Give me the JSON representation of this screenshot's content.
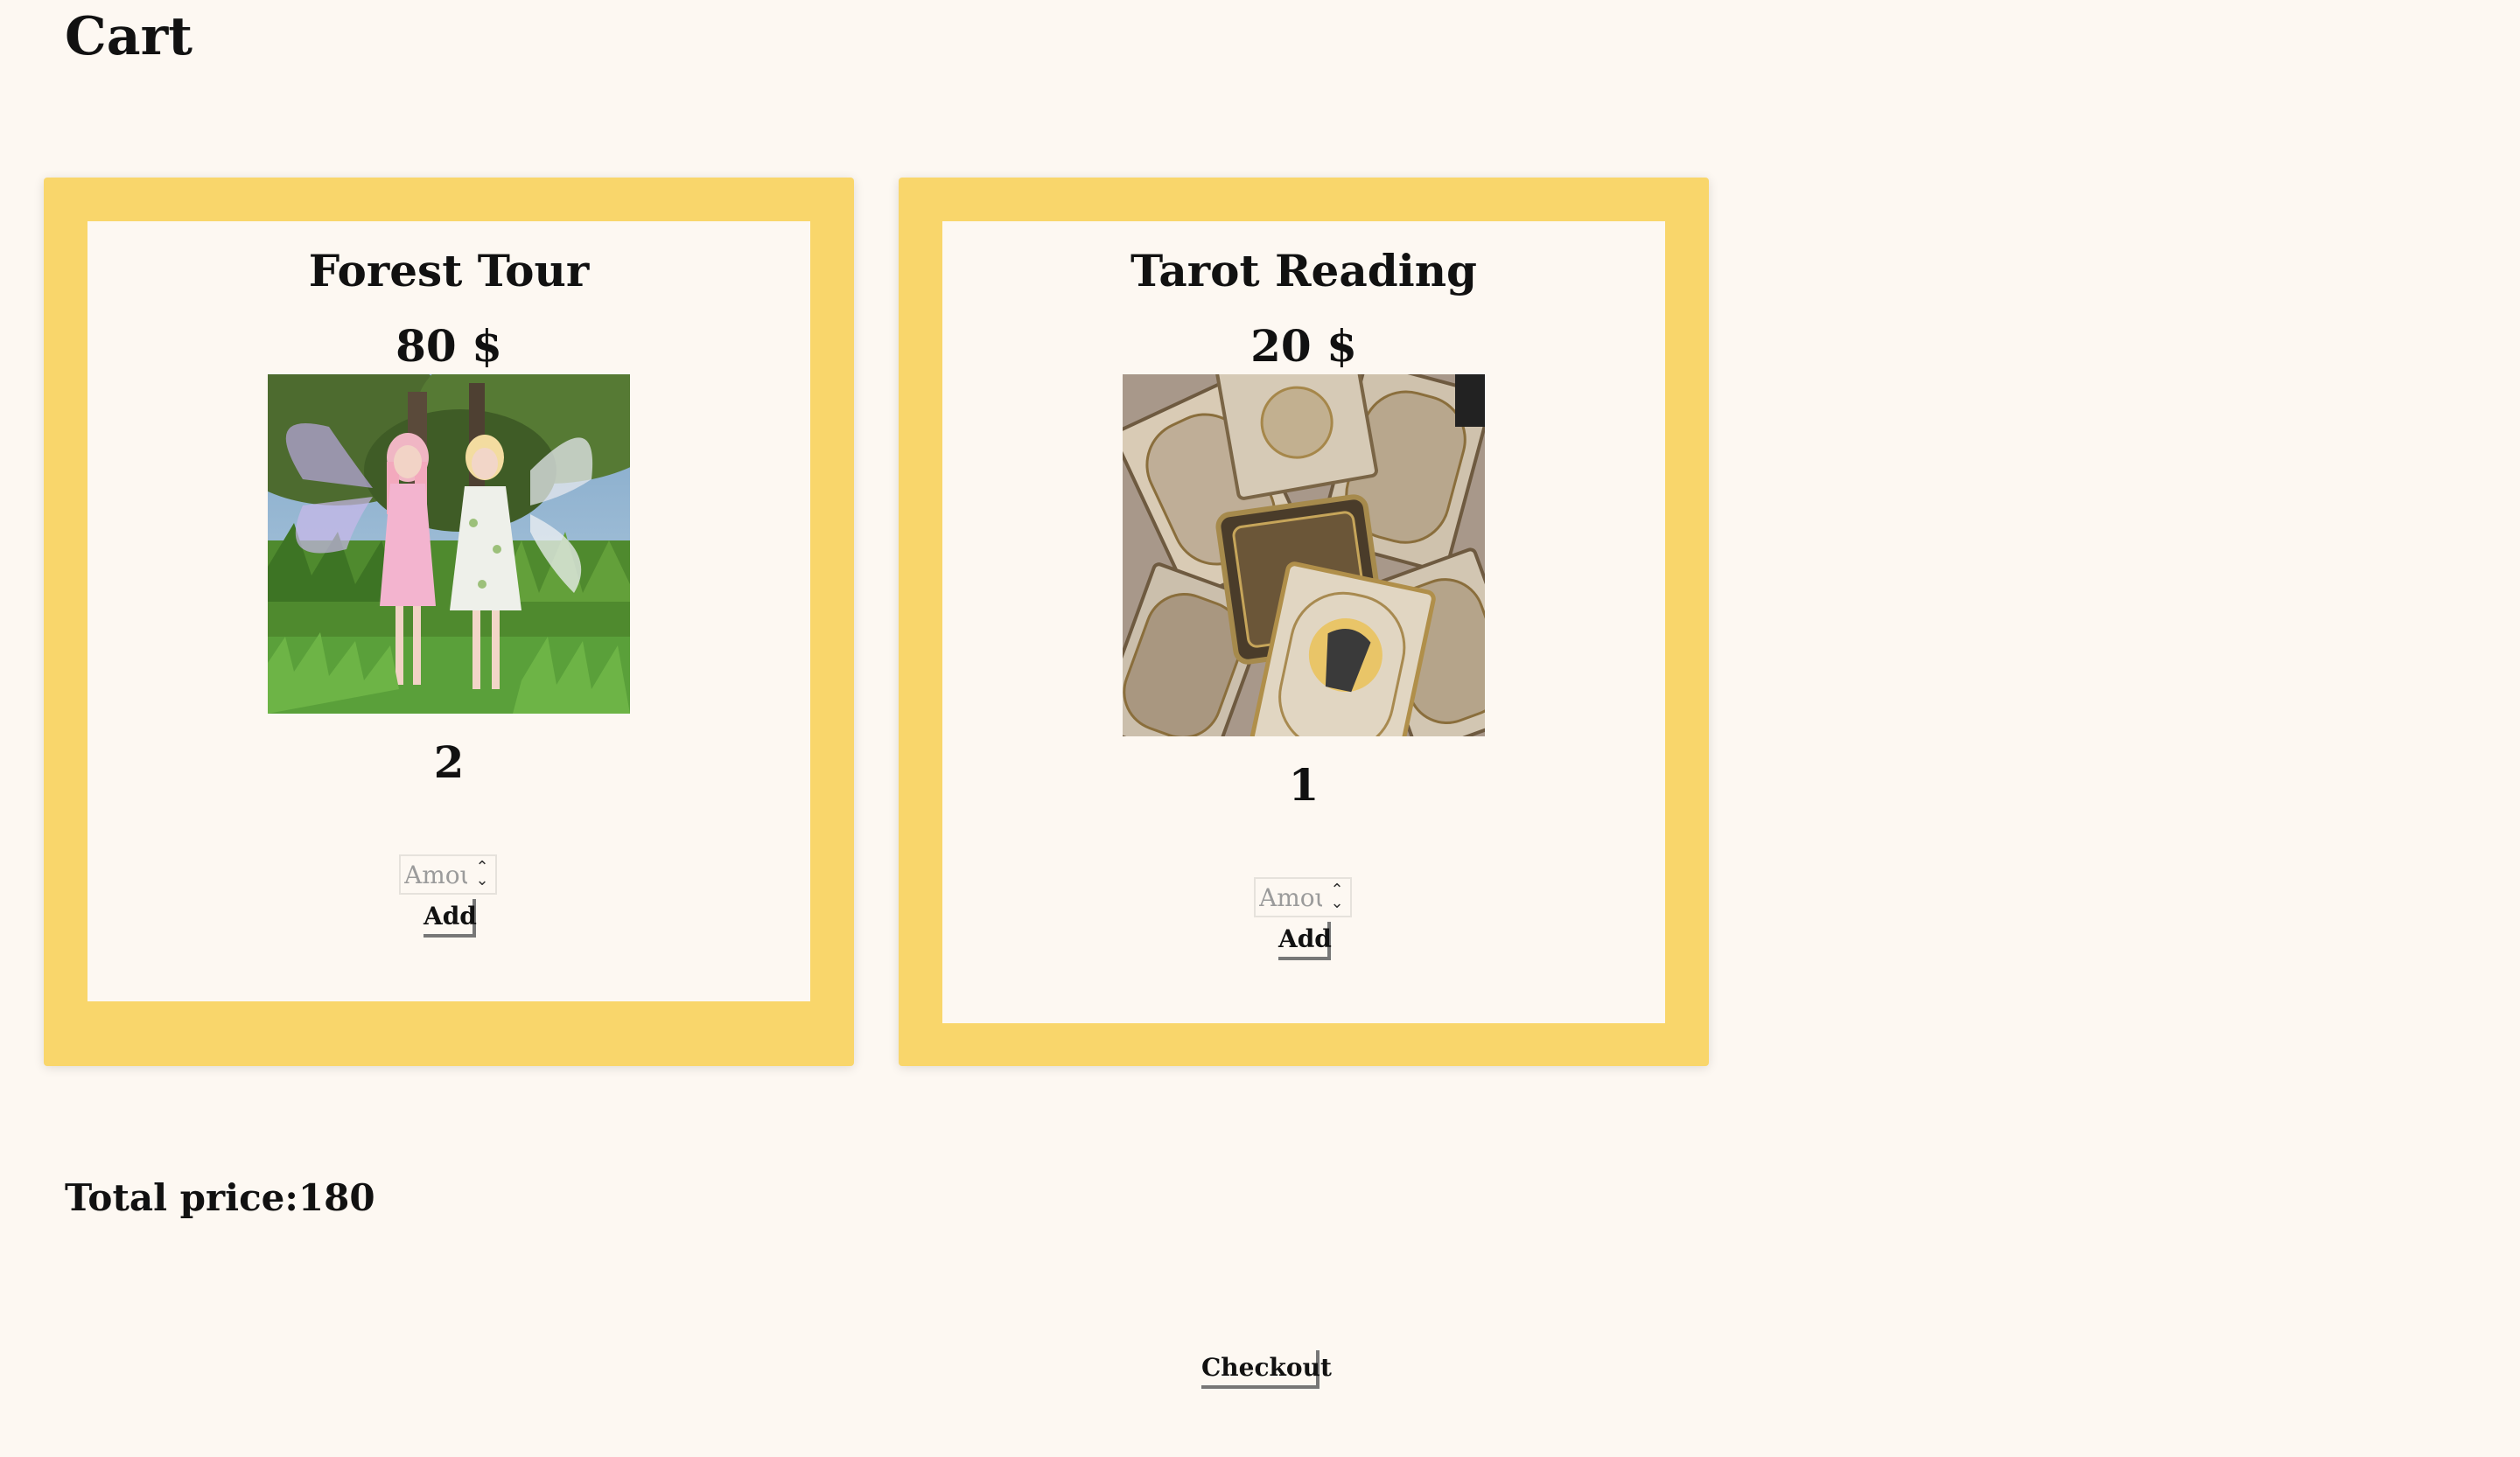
{
  "page": {
    "title": "Cart",
    "background": "#fdf8f2",
    "accent": "#f9d66b"
  },
  "cart": {
    "items": [
      {
        "name": "Forest Tour",
        "price": "80 $",
        "quantity": "2",
        "amount_placeholder": "Amount",
        "add_label": "Add"
      },
      {
        "name": "Tarot Reading",
        "price": "20 $",
        "quantity": "1",
        "amount_placeholder": "Amount",
        "add_label": "Add"
      }
    ],
    "total_label": "Total price:180",
    "checkout_label": "Checkout"
  }
}
